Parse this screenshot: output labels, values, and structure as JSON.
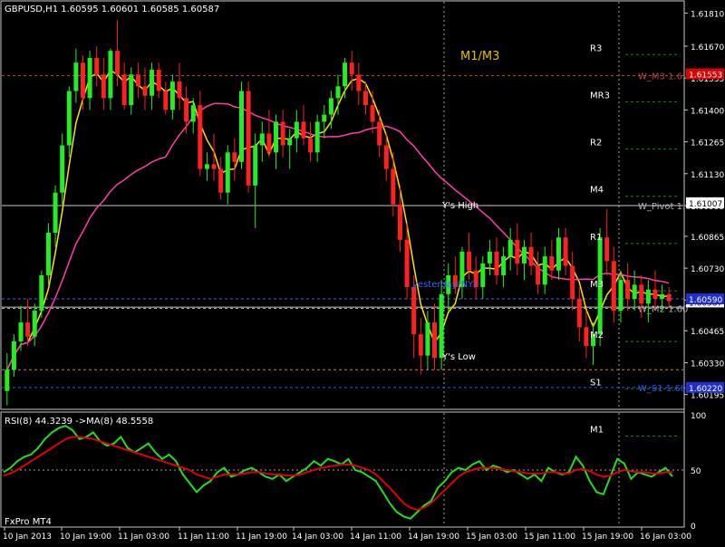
{
  "chart_data": [
    {
      "type": "candlestick",
      "symbol_header": "GBPUSD,H1  1.60595 1.60601 1.60585 1.60587",
      "ylim": [
        1.6014,
        1.6185
      ],
      "y_ticks": [
        "1.61810",
        "1.61670",
        "1.61535",
        "1.61400",
        "1.61265",
        "1.61130",
        "1.60995",
        "1.60865",
        "1.60730",
        "1.60595",
        "1.60465",
        "1.60330",
        "1.60195"
      ],
      "price_boxes": [
        {
          "label": "1.61553",
          "value": 1.61553,
          "color": "#e00000"
        },
        {
          "label": "1.61007",
          "value": 1.61007,
          "color": "#ffffff"
        },
        {
          "label": "1.60587",
          "value": 1.60587,
          "color": "#ffffff"
        },
        {
          "label": "1.60590",
          "value": 1.606,
          "color": "#1f2fcc"
        },
        {
          "label": "1.60220",
          "value": 1.60225,
          "color": "#1f2fcc"
        }
      ],
      "pivot_labels": [
        {
          "text": "R3",
          "value": 1.61665
        },
        {
          "text": "MR3",
          "value": 1.61465
        },
        {
          "text": "R2",
          "value": 1.61265
        },
        {
          "text": "M4",
          "value": 1.61065
        },
        {
          "text": "R1",
          "value": 1.60865
        },
        {
          "text": "M3",
          "value": 1.60665
        },
        {
          "text": "M2",
          "value": 1.6045
        },
        {
          "text": "S1",
          "value": 1.6025
        },
        {
          "text": "M1",
          "value": 1.6005
        }
      ],
      "level_lines": [
        {
          "label": "W_M3 1.6",
          "value": 1.61545,
          "color": "#c04040"
        },
        {
          "label": "W_Pivot 1.6",
          "value": 1.60995,
          "color": "#b0b0b0"
        },
        {
          "label": "W_M2 1.60",
          "value": 1.6056,
          "color": "#b0b0b0"
        },
        {
          "label": "W_S1 1.60",
          "value": 1.60225,
          "color": "#3050ff"
        }
      ],
      "annotations": [
        {
          "text": "M1/M3",
          "color": "#e0c000"
        },
        {
          "text": "Y's High",
          "color": "#ffffff"
        },
        {
          "text": "Y's Low",
          "color": "#ffffff"
        },
        {
          "text": "yesterday(NY)",
          "color": "#4060ff"
        }
      ],
      "x_ticks": [
        "10 Jan 2013",
        "10 Jan 19:00",
        "11 Jan 03:00",
        "11 Jan 11:00",
        "11 Jan 19:00",
        "14 Jan 03:00",
        "14 Jan 11:00",
        "14 Jan 19:00",
        "15 Jan 03:00",
        "15 Jan 11:00",
        "15 Jan 19:00",
        "16 Jan 03:00"
      ],
      "candles": [
        [
          1.6021,
          1.6037,
          1.6015,
          1.603
        ],
        [
          1.603,
          1.6045,
          1.6027,
          1.6042
        ],
        [
          1.6042,
          1.6057,
          1.6038,
          1.605
        ],
        [
          1.605,
          1.606,
          1.604,
          1.6044
        ],
        [
          1.6044,
          1.6058,
          1.604,
          1.6055
        ],
        [
          1.6055,
          1.6072,
          1.6052,
          1.607
        ],
        [
          1.607,
          1.6092,
          1.6066,
          1.6088
        ],
        [
          1.6088,
          1.6108,
          1.6082,
          1.6105
        ],
        [
          1.6105,
          1.613,
          1.61,
          1.6125
        ],
        [
          1.6125,
          1.615,
          1.612,
          1.6148
        ],
        [
          1.6148,
          1.6166,
          1.6143,
          1.616
        ],
        [
          1.616,
          1.6163,
          1.614,
          1.6145
        ],
        [
          1.6145,
          1.6165,
          1.614,
          1.6162
        ],
        [
          1.6162,
          1.6167,
          1.615,
          1.6155
        ],
        [
          1.6155,
          1.6162,
          1.614,
          1.6145
        ],
        [
          1.6145,
          1.6166,
          1.614,
          1.6165
        ],
        [
          1.6165,
          1.6178,
          1.615,
          1.6155
        ],
        [
          1.6155,
          1.616,
          1.614,
          1.6142
        ],
        [
          1.6142,
          1.6158,
          1.6138,
          1.6155
        ],
        [
          1.6155,
          1.616,
          1.6145,
          1.615
        ],
        [
          1.615,
          1.6158,
          1.614,
          1.6146
        ],
        [
          1.6146,
          1.616,
          1.614,
          1.6157
        ],
        [
          1.6157,
          1.616,
          1.6145,
          1.6148
        ],
        [
          1.6148,
          1.6152,
          1.6138,
          1.614
        ],
        [
          1.614,
          1.6155,
          1.6136,
          1.6152
        ],
        [
          1.6152,
          1.616,
          1.614,
          1.6145
        ],
        [
          1.6145,
          1.615,
          1.613,
          1.6135
        ],
        [
          1.6135,
          1.6145,
          1.613,
          1.6142
        ],
        [
          1.6142,
          1.6148,
          1.6112,
          1.6115
        ],
        [
          1.6115,
          1.6122,
          1.611,
          1.6117
        ],
        [
          1.6117,
          1.613,
          1.611,
          1.6115
        ],
        [
          1.6115,
          1.612,
          1.6102,
          1.6105
        ],
        [
          1.6105,
          1.6125,
          1.61,
          1.6122
        ],
        [
          1.6122,
          1.6128,
          1.611,
          1.6118
        ],
        [
          1.6118,
          1.6152,
          1.6115,
          1.6148
        ],
        [
          1.6148,
          1.6152,
          1.6105,
          1.6108
        ],
        [
          1.6108,
          1.613,
          1.609,
          1.6125
        ],
        [
          1.6125,
          1.6135,
          1.6118,
          1.613
        ],
        [
          1.613,
          1.614,
          1.612,
          1.6122
        ],
        [
          1.6122,
          1.6138,
          1.6115,
          1.6135
        ],
        [
          1.6135,
          1.614,
          1.612,
          1.6125
        ],
        [
          1.6125,
          1.6132,
          1.6115,
          1.6128
        ],
        [
          1.6128,
          1.614,
          1.6122,
          1.6135
        ],
        [
          1.6135,
          1.6142,
          1.6125,
          1.6128
        ],
        [
          1.6128,
          1.6135,
          1.6118,
          1.6122
        ],
        [
          1.6122,
          1.6138,
          1.6118,
          1.6135
        ],
        [
          1.6135,
          1.6142,
          1.6128,
          1.6138
        ],
        [
          1.6138,
          1.6148,
          1.6132,
          1.6145
        ],
        [
          1.6145,
          1.6155,
          1.6138,
          1.615
        ],
        [
          1.615,
          1.6162,
          1.6145,
          1.616
        ],
        [
          1.616,
          1.6165,
          1.6148,
          1.6155
        ],
        [
          1.6155,
          1.616,
          1.6142,
          1.6148
        ],
        [
          1.6148,
          1.6152,
          1.6138,
          1.6142
        ],
        [
          1.6142,
          1.6148,
          1.613,
          1.6135
        ],
        [
          1.6135,
          1.614,
          1.612,
          1.6125
        ],
        [
          1.6125,
          1.613,
          1.611,
          1.6115
        ],
        [
          1.6115,
          1.6122,
          1.6095,
          1.61
        ],
        [
          1.61,
          1.6108,
          1.608,
          1.6085
        ],
        [
          1.6085,
          1.6092,
          1.606,
          1.6065
        ],
        [
          1.6065,
          1.607,
          1.6035,
          1.6045
        ],
        [
          1.6045,
          1.6052,
          1.6028,
          1.6036
        ],
        [
          1.6036,
          1.6055,
          1.603,
          1.605
        ],
        [
          1.605,
          1.6058,
          1.603,
          1.6035
        ],
        [
          1.6035,
          1.6068,
          1.603,
          1.6062
        ],
        [
          1.6062,
          1.6075,
          1.6055,
          1.607
        ],
        [
          1.607,
          1.6078,
          1.6062,
          1.6065
        ],
        [
          1.6065,
          1.6082,
          1.606,
          1.608
        ],
        [
          1.608,
          1.6088,
          1.6068,
          1.6072
        ],
        [
          1.6072,
          1.6078,
          1.606,
          1.6065
        ],
        [
          1.6065,
          1.6078,
          1.606,
          1.6075
        ],
        [
          1.6075,
          1.6085,
          1.607,
          1.608
        ],
        [
          1.608,
          1.6086,
          1.6066,
          1.607
        ],
        [
          1.607,
          1.6082,
          1.6065,
          1.6078
        ],
        [
          1.6078,
          1.609,
          1.6072,
          1.6085
        ],
        [
          1.6085,
          1.6092,
          1.607,
          1.6075
        ],
        [
          1.6075,
          1.6085,
          1.6068,
          1.6082
        ],
        [
          1.6082,
          1.6088,
          1.607,
          1.6074
        ],
        [
          1.6074,
          1.608,
          1.6062,
          1.6066
        ],
        [
          1.6066,
          1.6082,
          1.6062,
          1.6078
        ],
        [
          1.6078,
          1.6085,
          1.6068,
          1.6072
        ],
        [
          1.6072,
          1.609,
          1.6068,
          1.6086
        ],
        [
          1.6086,
          1.609,
          1.607,
          1.6074
        ],
        [
          1.6074,
          1.608,
          1.6055,
          1.606
        ],
        [
          1.606,
          1.6065,
          1.6042,
          1.6048
        ],
        [
          1.6048,
          1.6055,
          1.6035,
          1.604
        ],
        [
          1.604,
          1.605,
          1.6032,
          1.6045
        ],
        [
          1.6045,
          1.609,
          1.604,
          1.6086
        ],
        [
          1.6086,
          1.6098,
          1.607,
          1.6076
        ],
        [
          1.6076,
          1.6082,
          1.605,
          1.6055
        ],
        [
          1.6055,
          1.6072,
          1.605,
          1.6068
        ],
        [
          1.6068,
          1.6075,
          1.6055,
          1.606
        ],
        [
          1.606,
          1.6072,
          1.6055,
          1.6066
        ],
        [
          1.6066,
          1.607,
          1.6052,
          1.6058
        ],
        [
          1.6058,
          1.6068,
          1.605,
          1.6064
        ],
        [
          1.6064,
          1.6072,
          1.6056,
          1.606
        ],
        [
          1.606,
          1.6066,
          1.6055,
          1.6062
        ],
        [
          1.6062,
          1.6065,
          1.6056,
          1.6059
        ]
      ],
      "series": [
        {
          "name": "MA fast",
          "color": "#ffe000"
        },
        {
          "name": "MA slow",
          "color": "#ff3fa6"
        }
      ]
    },
    {
      "type": "line",
      "header": "RSI(8) 44.3239  ->MA(8) 48.5558",
      "footer": "FxPro MT4",
      "ylim": [
        0,
        100
      ],
      "y_ticks": [
        "100",
        "50",
        "0"
      ],
      "levels": [
        50
      ],
      "series": [
        {
          "name": "RSI",
          "color": "#22dd22",
          "values": [
            48,
            52,
            58,
            62,
            64,
            70,
            78,
            84,
            88,
            90,
            86,
            78,
            80,
            84,
            76,
            72,
            74,
            80,
            70,
            66,
            70,
            74,
            66,
            60,
            64,
            58,
            46,
            38,
            30,
            36,
            40,
            48,
            52,
            44,
            46,
            50,
            52,
            48,
            44,
            42,
            46,
            40,
            44,
            48,
            52,
            58,
            54,
            60,
            58,
            55,
            60,
            50,
            48,
            44,
            40,
            30,
            20,
            12,
            8,
            6,
            12,
            18,
            22,
            34,
            40,
            48,
            52,
            50,
            55,
            58,
            50,
            54,
            52,
            48,
            50,
            46,
            42,
            46,
            40,
            52,
            48,
            46,
            48,
            62,
            54,
            40,
            30,
            28,
            44,
            60,
            56,
            42,
            48,
            46,
            44,
            48,
            52,
            44
          ]
        },
        {
          "name": "MA",
          "color": "#e00000",
          "values": [
            45,
            47,
            50,
            54,
            58,
            62,
            66,
            70,
            74,
            78,
            80,
            80,
            79,
            78,
            76,
            74,
            72,
            70,
            68,
            66,
            64,
            62,
            60,
            58,
            56,
            54,
            52,
            50,
            46,
            44,
            42,
            44,
            46,
            46,
            46,
            47,
            48,
            48,
            47,
            46,
            46,
            45,
            45,
            46,
            48,
            50,
            52,
            53,
            54,
            55,
            55,
            54,
            52,
            50,
            46,
            40,
            34,
            27,
            20,
            16,
            14,
            16,
            20,
            26,
            32,
            38,
            44,
            48,
            50,
            52,
            52,
            52,
            51,
            50,
            49,
            48,
            47,
            47,
            47,
            48,
            48,
            47,
            47,
            50,
            51,
            49,
            46,
            44,
            45,
            48,
            50,
            49,
            48,
            48,
            47,
            47,
            48,
            48
          ]
        }
      ]
    }
  ]
}
